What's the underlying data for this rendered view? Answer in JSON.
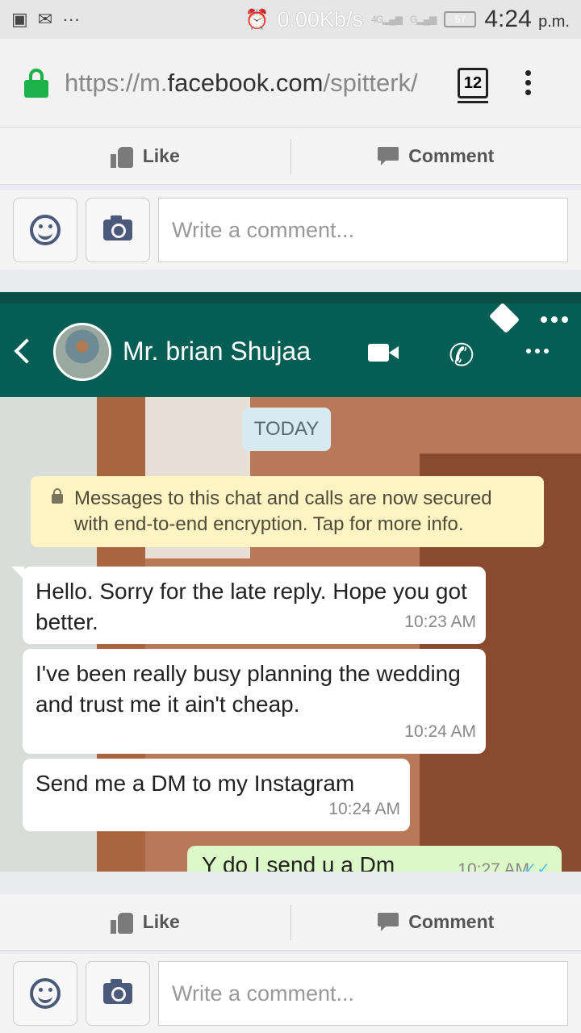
{
  "status_bar": {
    "speed": "0.00Kb/s",
    "network_1": "4G",
    "network_2": "G",
    "battery": "57",
    "time": "4:24",
    "ampm": "p.m."
  },
  "browser": {
    "url_prefix": "https://m.",
    "url_domain": "facebook.com",
    "url_path": "/spitterk/",
    "tab_count": "12"
  },
  "post_actions_top": {
    "like_label": "Like",
    "comment_label": "Comment",
    "comment_placeholder": "Write a comment..."
  },
  "whatsapp": {
    "contact_name": "Mr. brian Shujaa",
    "date_chip": "TODAY",
    "encryption_notice": "Messages to this chat and calls are now secured with end-to-end encryption. Tap for more info.",
    "messages": [
      {
        "text": "Hello. Sorry for the late reply.  Hope you got better.",
        "time": "10:23 AM",
        "direction": "incoming"
      },
      {
        "text": "I've been really busy planning the wedding and trust me it ain't cheap.",
        "time": "10:24 AM",
        "direction": "incoming"
      },
      {
        "text": "Send me a DM to my Instagram",
        "time": "10:24 AM",
        "direction": "incoming"
      },
      {
        "text": "Y do I send u a Dm",
        "time": "10:27 AM",
        "direction": "outgoing"
      }
    ],
    "colors": {
      "header": "#075e54",
      "outgoing": "#dcf8c6",
      "notice": "#fdf4c3"
    }
  },
  "post_actions_bottom": {
    "like_label": "Like",
    "comment_label": "Comment",
    "comment_placeholder": "Write a comment..."
  },
  "icons": {
    "lock": "lock-icon",
    "thumb": "thumbs-up-icon",
    "comment": "comment-icon",
    "smiley": "smiley-icon",
    "camera": "camera-icon"
  }
}
